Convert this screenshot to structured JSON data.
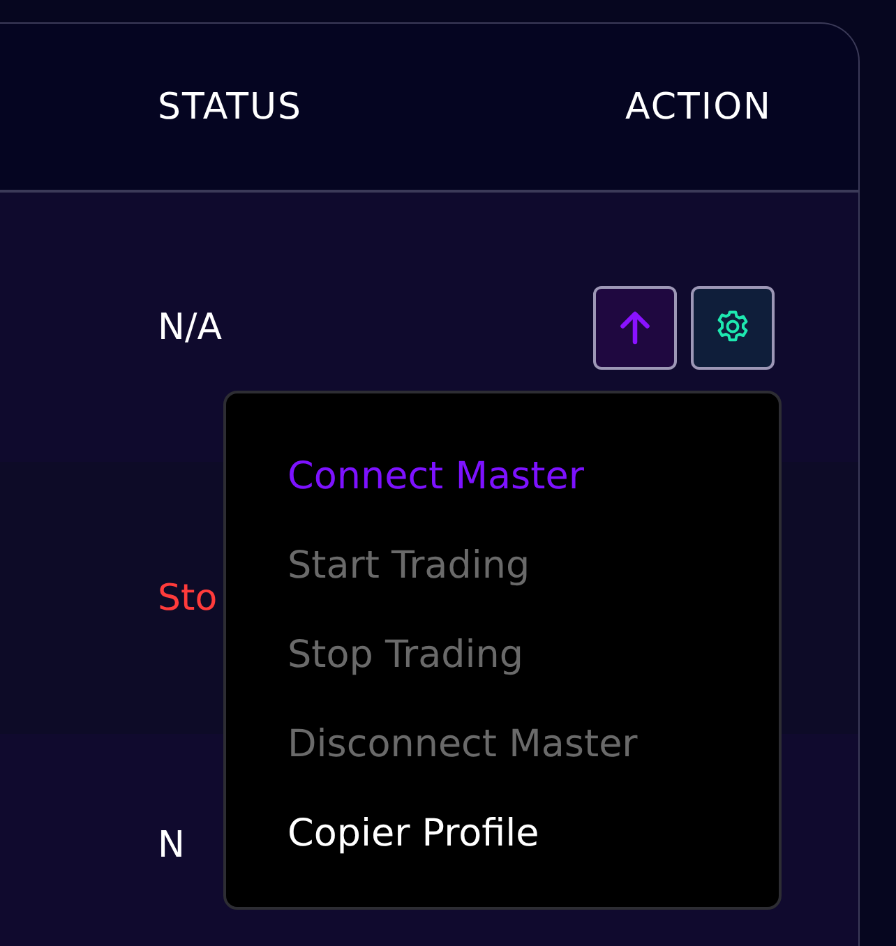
{
  "table": {
    "columns": [
      "STATUS",
      "ACTION"
    ],
    "rows": [
      {
        "status": "N/A",
        "color": "#ffffff",
        "actions": [
          {
            "kind": "upload"
          },
          {
            "kind": "settings"
          }
        ]
      },
      {
        "status": "Sto",
        "color": "#ff3b3b"
      },
      {
        "status": "N",
        "color": "#ffffff"
      }
    ]
  },
  "menu": {
    "items": [
      {
        "label": "Connect Master",
        "selected": true,
        "disabled": false
      },
      {
        "label": "Start Trading",
        "selected": false,
        "disabled": true
      },
      {
        "label": "Stop Trading",
        "selected": false,
        "disabled": true
      },
      {
        "label": "Disconnect Master",
        "selected": false,
        "disabled": true
      },
      {
        "label": "Copier Profile",
        "selected": false,
        "disabled": false
      }
    ]
  }
}
